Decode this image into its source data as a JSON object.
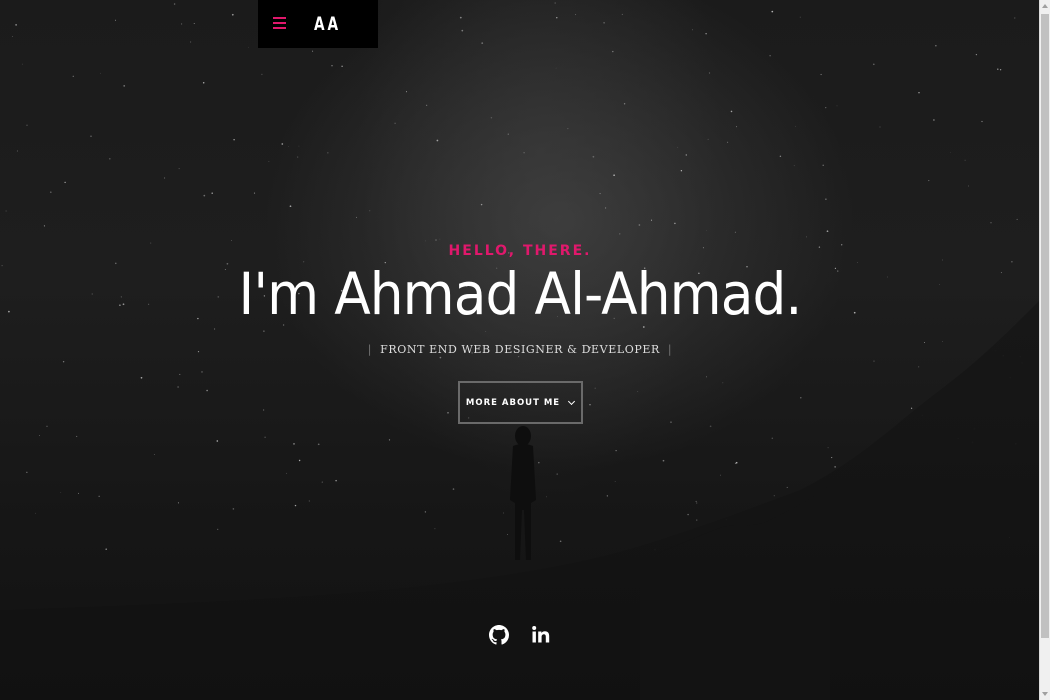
{
  "header": {
    "logo_text": "AA",
    "menu_icon": "hamburger-menu-icon"
  },
  "hero": {
    "greeting": "HELLO, THERE.",
    "name": "I'm Ahmad Al-Ahmad.",
    "role_divider": "|",
    "role": "FRONT END WEB DESIGNER & DEVELOPER",
    "button_label": "MORE ABOUT ME",
    "button_icon": "chevron-down-icon"
  },
  "social": {
    "links": [
      {
        "icon": "github-icon"
      },
      {
        "icon": "linkedin-icon"
      }
    ]
  },
  "colors": {
    "accent": "#e0186c",
    "background": "#1a1a1a",
    "text": "#ffffff"
  }
}
